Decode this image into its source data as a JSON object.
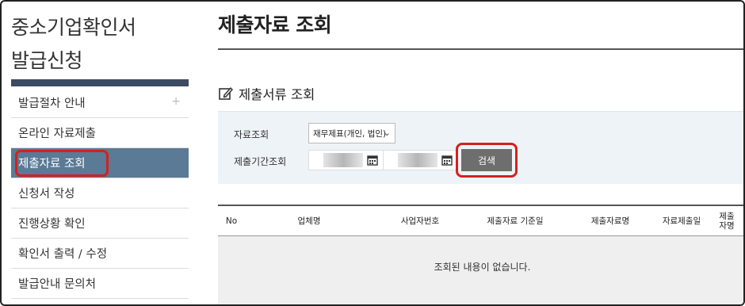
{
  "sidebar": {
    "title_line1": "중소기업확인서",
    "title_line2": "발급신청",
    "items": [
      {
        "label": "발급절차 안내",
        "plus": "+"
      },
      {
        "label": "온라인 자료제출"
      },
      {
        "label": "제출자료 조회"
      },
      {
        "label": "신청서 작성"
      },
      {
        "label": "진행상황 확인"
      },
      {
        "label": "확인서 출력 / 수정"
      },
      {
        "label": "발급안내 문의처"
      }
    ]
  },
  "main": {
    "page_title": "제출자료 조회",
    "section_title": "제출서류 조회",
    "search": {
      "data_label": "자료조회",
      "data_select_value": "재무제표(개인, 법인)",
      "period_label": "제출기간조회",
      "search_button": "검색"
    },
    "table": {
      "columns": [
        "No",
        "업체명",
        "사업자번호",
        "제출자료 기준일",
        "제출자료명",
        "자료제출일",
        "제출자명"
      ],
      "empty_message": "조회된 내용이 없습니다."
    }
  },
  "colors": {
    "active_nav": "#5a7a95",
    "nav_bar": "#3d4a63",
    "highlight": "#d42020",
    "search_bg": "#eef3f8"
  }
}
